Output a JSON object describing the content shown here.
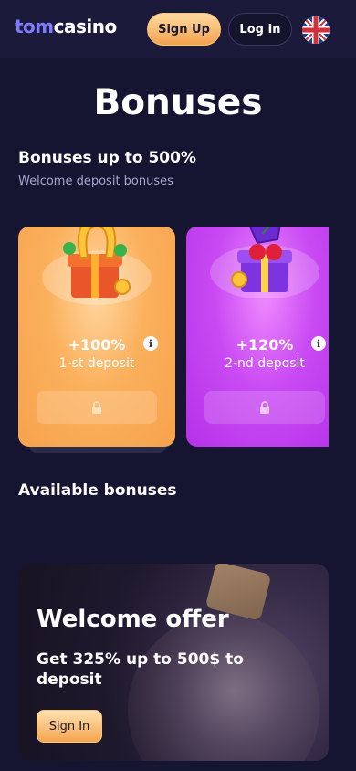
{
  "header": {
    "logo_part1": "tom",
    "logo_part2": "casino",
    "signup_label": "Sign Up",
    "login_label": "Log In",
    "language_icon": "uk-flag-icon"
  },
  "page": {
    "title": "Bonuses"
  },
  "deposit_section": {
    "title": "Bonuses up to 500%",
    "subtitle": "Welcome deposit bonuses",
    "cards": [
      {
        "percent": "+100%",
        "label": "1-st deposit",
        "color": "#f7a24c",
        "icon": "horseshoe-gift-icon",
        "locked": true
      },
      {
        "percent": "+120%",
        "label": "2-nd deposit",
        "color": "#b531e9",
        "icon": "cherry-gift-icon",
        "locked": true
      }
    ]
  },
  "available_section": {
    "title": "Available bonuses"
  },
  "welcome_offer": {
    "title": "Welcome offer",
    "description": "Get 325% up to 500$ to deposit",
    "button_label": "Sign In"
  },
  "colors": {
    "background": "#161531",
    "accent_orange": "#f3a24e",
    "accent_purple": "#b531e9",
    "logo_blue": "#7f7bff"
  }
}
